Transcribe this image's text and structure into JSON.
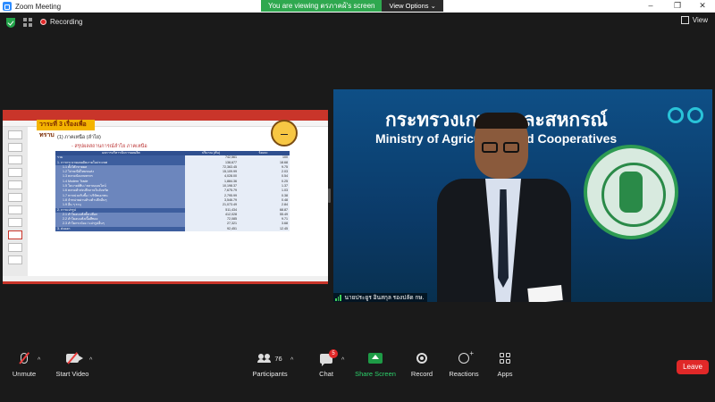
{
  "window": {
    "title": "Zoom Meeting"
  },
  "share_banner": {
    "viewing_text": "You are viewing ตรภาคผ้'s screen",
    "view_options": "View Options"
  },
  "top_bar": {
    "recording": "Recording",
    "view": "View"
  },
  "slide": {
    "heading": "วาระที่ 3 เรื่องเพื่อทราบ",
    "line1": "(1) ภาคเหนือ (ลำไย)",
    "line2": "- สรุปผลสถานการณ์ลำไย ภาคเหนือ",
    "table": {
      "headers": [
        "ผลการบริหารจัดการผลผลิต",
        "ปริมาณ (ตัน)",
        "ร้อยละ"
      ],
      "rows": [
        {
          "label": "รวม",
          "v1": "742,561",
          "v2": "100",
          "sub": false
        },
        {
          "label": "1. การกระจายผลผลิตภายในประเทศ",
          "v1": "138,677",
          "v2": "18.68",
          "sub": false
        },
        {
          "label": "1.1 ตั้งโต๊ะขายผล",
          "v1": "72,363.45",
          "v2": "9.75",
          "sub": true
        },
        {
          "label": "1.2 ไปรษณีย์ไทยขนส่ง",
          "v1": "15,109.99",
          "v2": "2.03",
          "sub": true
        },
        {
          "label": "1.3 ตลาดนัดเกษตรกร",
          "v1": "4,028.00",
          "v2": "0.54",
          "sub": true
        },
        {
          "label": "1.4 Modern Trade",
          "v1": "1,884.36",
          "v2": "0.25",
          "sub": true
        },
        {
          "label": "1.5 โมบายล์พิบ / ตลาดออนไลน์",
          "v1": "10,198.37",
          "v2": "1.37",
          "sub": true
        },
        {
          "label": "1.6 ตลาดค้าส่งปลีกภายในจังหวัด",
          "v1": "7,675.79",
          "v2": "1.03",
          "sub": true
        },
        {
          "label": "1.7 หาหน่วยรับซื้อ / บริษัทเอกชน",
          "v1": "2,795.99",
          "v2": "0.38",
          "sub": true
        },
        {
          "label": "1.8 จำหน่ายผ่านห้างค้าปลีกอื่นๆ",
          "v1": "3,546.79",
          "v2": "0.48",
          "sub": true
        },
        {
          "label": "1.9 อื่น ๆ ระบุ",
          "v1": "21,073.49",
          "v2": "2.84",
          "sub": true
        },
        {
          "label": "2. การแปรรูป",
          "v1": "511,434",
          "v2": "68.87",
          "sub": false
        },
        {
          "label": "2.1 ลำไยอบแห้งทั้งเปลือก",
          "v1": "412,028",
          "v2": "55.49",
          "sub": true
        },
        {
          "label": "2.2 ลำไยอบแห้งเนื้อสีทอง",
          "v1": "72,085",
          "v2": "9.71",
          "sub": true
        },
        {
          "label": "2.3 ลำไยกระป๋อง / แปรรูปอื่นๆ",
          "v1": "27,321",
          "v2": "3.68",
          "sub": true
        },
        {
          "label": "3. ส่งออก",
          "v1": "92,451",
          "v2": "12.45",
          "sub": false
        }
      ]
    }
  },
  "video": {
    "ministry_th": "กระทรวงเกษตรและสหกรณ์",
    "ministry_en": "Ministry of Agriculture and Cooperatives",
    "name_tag": "นายประยูร อินสกุล รองปลัด กษ."
  },
  "toolbar": {
    "unmute": "Unmute",
    "start_video": "Start Video",
    "participants": "Participants",
    "participants_count": "76",
    "chat": "Chat",
    "chat_badge": "5",
    "share_screen": "Share Screen",
    "record": "Record",
    "reactions": "Reactions",
    "apps": "Apps",
    "leave": "Leave"
  },
  "colors": {
    "share_banner": "#2fa84f",
    "leave": "#e02828",
    "share_screen": "#1e9b46",
    "slide_heading": "#f4b400",
    "table_header": "#2f4f8f"
  }
}
